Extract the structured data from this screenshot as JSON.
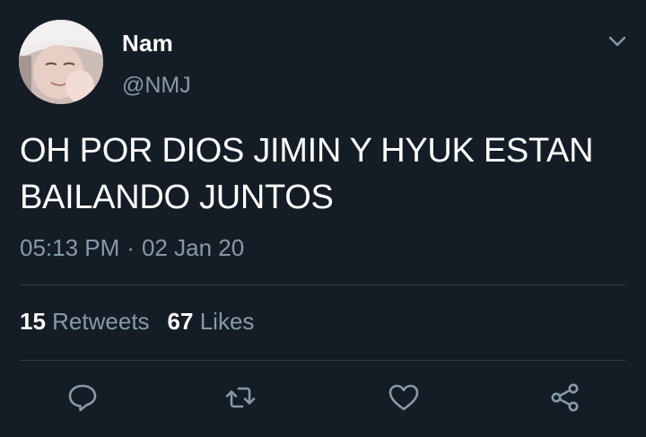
{
  "tweet": {
    "author": {
      "name": "Nam",
      "handle": "@NMJ"
    },
    "text": "OH POR DIOS JIMIN Y HYUK ESTAN BAILANDO JUNTOS",
    "time": "05:13 PM",
    "separator": "·",
    "date": "02 Jan 20",
    "stats": {
      "retweets_count": "15",
      "retweets_label": "Retweets",
      "likes_count": "67",
      "likes_label": "Likes"
    }
  },
  "icons": {
    "menu": "chevron-down-icon",
    "reply": "reply-icon",
    "retweet": "retweet-icon",
    "like": "heart-icon",
    "share": "share-icon"
  },
  "colors": {
    "background": "#141d26",
    "secondary_text": "#8899a6",
    "divider": "#2f3a45",
    "primary_text": "#ffffff"
  }
}
